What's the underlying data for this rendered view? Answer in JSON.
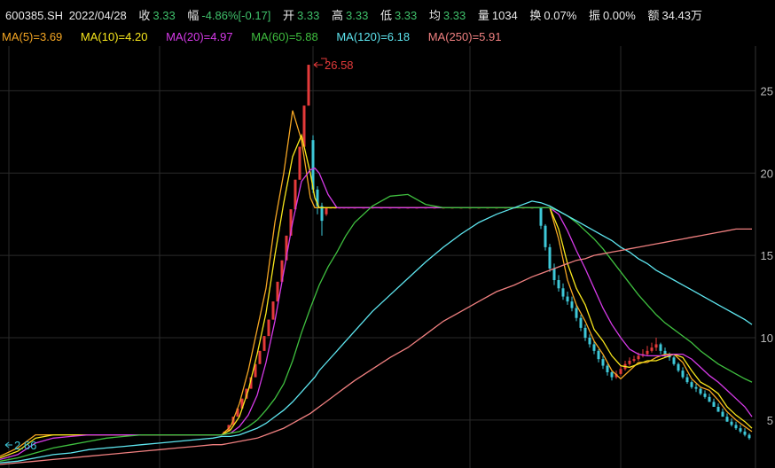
{
  "header": {
    "code": "600385.SH",
    "date": "2022/04/28",
    "close_label": "收",
    "close_value": "3.33",
    "change_label": "幅",
    "change_value": "-4.86%[-0.17]",
    "open_label": "开",
    "open_value": "3.33",
    "high_label": "高",
    "high_value": "3.33",
    "low_label": "低",
    "low_value": "3.33",
    "avg_label": "均",
    "avg_value": "3.33",
    "volume_label": "量",
    "volume_value": "1034",
    "turnover_label": "换",
    "turnover_value": "0.07%",
    "amplitude_label": "振",
    "amplitude_value": "0.00%",
    "amount_label": "额",
    "amount_value": "34.43万"
  },
  "ma_legend": [
    {
      "label": "MA(5)=3.69",
      "color": "#f5a623"
    },
    {
      "label": "MA(10)=4.20",
      "color": "#f8e71c"
    },
    {
      "label": "MA(20)=4.97",
      "color": "#d63ae8"
    },
    {
      "label": "MA(60)=5.88",
      "color": "#3fbf3f"
    },
    {
      "label": "MA(120)=6.18",
      "color": "#5ee6f0"
    },
    {
      "label": "MA(250)=5.91",
      "color": "#f08080"
    }
  ],
  "colors": {
    "up": "#e33a3a",
    "down": "#3ec8d8",
    "grid": "#2a2a2a",
    "annotation": "#e33a3a",
    "low_annotation": "#3ec8d8"
  },
  "chart_data": {
    "type": "line",
    "title": "",
    "x": [
      0,
      20,
      40,
      60,
      80,
      100,
      120,
      140,
      160,
      180,
      200,
      220,
      240,
      250,
      260,
      270,
      280,
      290,
      300,
      310,
      320,
      330,
      340,
      350,
      355,
      360,
      370,
      380,
      390,
      400,
      420,
      440,
      460,
      480,
      500,
      520,
      540,
      560,
      580,
      600,
      610,
      620,
      630,
      640,
      650,
      660,
      670,
      680,
      690,
      700,
      710,
      720,
      730,
      740,
      750,
      760,
      770,
      780,
      790,
      800,
      810,
      820,
      830,
      840,
      848
    ],
    "ylim": [
      2.3,
      27.5
    ],
    "y_ticks": [
      5,
      10,
      15,
      20,
      25
    ],
    "y_tick_labels": [
      "5",
      "10",
      "15",
      "20",
      "25"
    ],
    "grid": true,
    "series": [
      {
        "label_ref": "MA(5)",
        "color": "#f5a623",
        "values": [
          2.8,
          3.3,
          4.1,
          4.1,
          4.1,
          4.1,
          4.1,
          4.1,
          4.1,
          4.1,
          4.1,
          4.1,
          4.1,
          4.1,
          4.6,
          6,
          8,
          10.5,
          13,
          17,
          20,
          23.8,
          22,
          18.5,
          17.9,
          17.9,
          17.9,
          17.9,
          17.9,
          17.9,
          17.9,
          17.9,
          17.9,
          17.9,
          17.9,
          17.9,
          17.9,
          17.9,
          17.9,
          17.9,
          17.9,
          17.9,
          16,
          13.5,
          12,
          11,
          9.8,
          9,
          8,
          7.5,
          8,
          8.5,
          8.5,
          8.8,
          9,
          9,
          8.5,
          7.5,
          7,
          6.8,
          6.2,
          5.5,
          5,
          4.6,
          4.3
        ]
      },
      {
        "label_ref": "MA(10)",
        "color": "#f8e71c",
        "values": [
          2.7,
          3.1,
          3.9,
          4.1,
          4.1,
          4.1,
          4.1,
          4.1,
          4.1,
          4.1,
          4.1,
          4.1,
          4.1,
          4.1,
          4.4,
          5.2,
          6.8,
          9,
          11.5,
          15,
          18.2,
          21,
          22.3,
          20,
          18.5,
          17.9,
          17.9,
          17.9,
          17.9,
          17.9,
          17.9,
          17.9,
          17.9,
          17.9,
          17.9,
          17.9,
          17.9,
          17.9,
          17.9,
          17.9,
          17.9,
          17.9,
          16.6,
          14.5,
          13,
          12,
          10.5,
          9.8,
          8.9,
          8.3,
          8.2,
          8.4,
          8.6,
          8.6,
          8.8,
          9,
          8.8,
          8,
          7.3,
          7,
          6.6,
          5.8,
          5.3,
          4.9,
          4.5
        ]
      },
      {
        "label_ref": "MA(20)",
        "color": "#d63ae8",
        "values": [
          2.6,
          2.9,
          3.6,
          3.9,
          4,
          4.1,
          4.1,
          4.1,
          4.1,
          4.1,
          4.1,
          4.1,
          4.1,
          4.1,
          4.2,
          4.6,
          5.3,
          6.5,
          8.5,
          11,
          14,
          17,
          19.5,
          20.2,
          20.3,
          20,
          18.7,
          17.9,
          17.9,
          17.9,
          17.9,
          17.9,
          17.9,
          17.9,
          17.9,
          17.9,
          17.9,
          17.9,
          17.9,
          17.9,
          17.9,
          17.9,
          17.5,
          16.5,
          15.3,
          14.2,
          13,
          11.8,
          10.8,
          10,
          9.3,
          9,
          8.9,
          8.9,
          8.9,
          9,
          9,
          8.7,
          8.2,
          7.7,
          7.3,
          6.8,
          6.3,
          5.8,
          5.2
        ]
      },
      {
        "label_ref": "MA(60)",
        "color": "#3fbf3f",
        "values": [
          2.5,
          2.7,
          3,
          3.3,
          3.5,
          3.7,
          3.9,
          4,
          4.1,
          4.1,
          4.1,
          4.1,
          4.1,
          4.1,
          4.2,
          4.3,
          4.6,
          5,
          5.6,
          6.3,
          7.2,
          8.6,
          10.3,
          11.8,
          12.5,
          13.2,
          14.3,
          15.2,
          16.2,
          17,
          18,
          18.6,
          18.7,
          18.1,
          17.9,
          17.9,
          17.9,
          17.9,
          17.9,
          17.9,
          17.9,
          17.9,
          17.7,
          17.4,
          17,
          16.5,
          16,
          15.4,
          14.7,
          14,
          13.3,
          12.6,
          12,
          11.4,
          10.9,
          10.5,
          10.1,
          9.7,
          9.2,
          8.8,
          8.4,
          8.1,
          7.8,
          7.5,
          7.3
        ]
      },
      {
        "label_ref": "MA(120)",
        "color": "#5ee6f0",
        "values": [
          2.4,
          2.5,
          2.7,
          2.9,
          3,
          3.2,
          3.3,
          3.4,
          3.5,
          3.6,
          3.7,
          3.8,
          3.9,
          4,
          4,
          4.1,
          4.3,
          4.5,
          4.8,
          5.2,
          5.6,
          6.1,
          6.7,
          7.3,
          7.6,
          8,
          8.6,
          9.2,
          9.8,
          10.4,
          11.6,
          12.6,
          13.6,
          14.6,
          15.5,
          16.3,
          17,
          17.5,
          17.9,
          18.3,
          18.2,
          18,
          17.7,
          17.4,
          17.1,
          16.8,
          16.5,
          16.2,
          15.9,
          15.5,
          15.2,
          14.8,
          14.5,
          14.1,
          13.8,
          13.5,
          13.2,
          12.9,
          12.6,
          12.3,
          12,
          11.7,
          11.4,
          11.1,
          10.8
        ]
      },
      {
        "label_ref": "MA(250)",
        "color": "#f08080",
        "values": [
          2.3,
          2.4,
          2.5,
          2.6,
          2.7,
          2.8,
          2.9,
          3,
          3.1,
          3.2,
          3.3,
          3.4,
          3.5,
          3.5,
          3.6,
          3.7,
          3.8,
          3.9,
          4.1,
          4.3,
          4.5,
          4.8,
          5.1,
          5.4,
          5.6,
          5.8,
          6.2,
          6.6,
          7,
          7.4,
          8.1,
          8.8,
          9.4,
          10.2,
          11,
          11.6,
          12.2,
          12.8,
          13.2,
          13.7,
          13.9,
          14.1,
          14.3,
          14.5,
          14.7,
          14.8,
          15,
          15.1,
          15.2,
          15.3,
          15.4,
          15.5,
          15.6,
          15.7,
          15.8,
          15.9,
          16,
          16.1,
          16.2,
          16.3,
          16.4,
          16.5,
          16.6,
          16.6,
          16.6
        ]
      }
    ],
    "candles": {
      "x": [
        253,
        258,
        263,
        268,
        273,
        278,
        283,
        288,
        293,
        298,
        303,
        308,
        313,
        318,
        323,
        328,
        333,
        338,
        343,
        348,
        353,
        358,
        363,
        368,
        373,
        378,
        383,
        388,
        393,
        400,
        410,
        420,
        430,
        440,
        450,
        460,
        470,
        480,
        490,
        500,
        510,
        520,
        530,
        540,
        550,
        560,
        570,
        580,
        590,
        600,
        610,
        615,
        620,
        625,
        630,
        635,
        640,
        645,
        650,
        655,
        660,
        665,
        670,
        675,
        680,
        685,
        690,
        695,
        700,
        705,
        710,
        715,
        720,
        725,
        730,
        735,
        740,
        745,
        750,
        755,
        760,
        765,
        770,
        775,
        780,
        785,
        790,
        795,
        800,
        805,
        810,
        815,
        820,
        825,
        830,
        835,
        840,
        845
      ],
      "open": [
        4.1,
        4.3,
        4.7,
        5.2,
        5.7,
        6.3,
        6.9,
        7.6,
        8.4,
        9.2,
        10.1,
        11.1,
        12.2,
        13.4,
        14.7,
        16.2,
        17.8,
        19.6,
        21.6,
        24.1,
        22,
        19,
        18,
        17.5,
        17.9,
        17.9,
        17.9,
        17.9,
        17.9,
        17.9,
        17.9,
        17.9,
        17.9,
        17.9,
        17.9,
        17.9,
        17.9,
        17.9,
        17.9,
        17.9,
        17.9,
        17.9,
        17.9,
        17.9,
        17.9,
        17.9,
        17.9,
        17.9,
        17.9,
        17.9,
        17.9,
        16.8,
        15.5,
        14.2,
        13.5,
        13,
        12.5,
        12.2,
        11.8,
        11.2,
        10.6,
        10,
        9.6,
        9.2,
        8.7,
        8.3,
        7.9,
        7.6,
        7.8,
        8.1,
        8.4,
        8.6,
        8.7,
        8.9,
        9,
        9.2,
        9.4,
        9.6,
        9.2,
        9,
        8.8,
        8.4,
        8,
        7.6,
        7.3,
        7,
        6.9,
        6.6,
        6.4,
        6.1,
        5.8,
        5.5,
        5.2,
        4.9,
        4.7,
        4.5,
        4.3,
        4.1
      ],
      "close": [
        4.3,
        4.7,
        5.2,
        5.7,
        6.3,
        6.9,
        7.6,
        8.4,
        9.2,
        10.1,
        11.1,
        12.2,
        13.4,
        14.7,
        16.2,
        17.8,
        19.6,
        21.6,
        24.1,
        26.58,
        19,
        18,
        17.1,
        17.9,
        17.9,
        17.9,
        17.9,
        17.9,
        17.9,
        17.9,
        17.9,
        17.9,
        17.9,
        17.9,
        17.9,
        17.9,
        17.9,
        17.9,
        17.9,
        17.9,
        17.9,
        17.9,
        17.9,
        17.9,
        17.9,
        17.9,
        17.9,
        17.9,
        17.9,
        17.9,
        16.8,
        15.5,
        14.2,
        13.5,
        13,
        12.5,
        12.2,
        11.8,
        11.2,
        10.6,
        10,
        9.6,
        9.2,
        8.7,
        8.3,
        7.9,
        7.6,
        7.8,
        8.1,
        8.4,
        8.6,
        8.7,
        8.9,
        9,
        9.2,
        9.4,
        9.6,
        9.2,
        9,
        8.8,
        8.4,
        8,
        7.6,
        7.3,
        7,
        6.9,
        6.6,
        6.4,
        6.1,
        5.8,
        5.5,
        5.2,
        4.9,
        4.7,
        4.5,
        4.3,
        4.1,
        3.9
      ],
      "high": [
        4.3,
        4.7,
        5.2,
        5.7,
        6.3,
        6.9,
        7.6,
        8.4,
        9.2,
        10.1,
        11.1,
        12.2,
        13.4,
        14.7,
        16.2,
        17.8,
        19.6,
        21.6,
        24.1,
        26.58,
        22.3,
        19.2,
        18.2,
        17.9,
        17.9,
        17.9,
        17.9,
        17.9,
        17.9,
        17.9,
        17.9,
        17.9,
        17.9,
        17.9,
        17.9,
        17.9,
        17.9,
        17.9,
        17.9,
        17.9,
        17.9,
        17.9,
        17.9,
        17.9,
        17.9,
        17.9,
        17.9,
        17.9,
        17.9,
        17.9,
        17.9,
        16.9,
        15.7,
        14.5,
        13.8,
        13.3,
        12.8,
        12.5,
        12,
        11.4,
        10.8,
        10.2,
        9.8,
        9.3,
        8.9,
        8.4,
        8,
        8,
        8.3,
        8.6,
        8.8,
        8.9,
        9.1,
        9.3,
        9.5,
        9.7,
        10,
        9.7,
        9.4,
        9.1,
        8.9,
        8.5,
        8.2,
        7.8,
        7.4,
        7.2,
        7,
        6.8,
        6.6,
        6.3,
        6,
        5.7,
        5.4,
        5.1,
        4.9,
        4.7,
        4.5,
        4.2
      ],
      "low": [
        4.1,
        4.3,
        4.7,
        5.2,
        5.7,
        6.3,
        6.9,
        7.6,
        8.4,
        9.2,
        10.1,
        11.1,
        12.2,
        13.4,
        14.7,
        16.2,
        17.8,
        19.6,
        21.6,
        24.1,
        18.8,
        17.5,
        16.2,
        17.4,
        17.9,
        17.9,
        17.9,
        17.9,
        17.9,
        17.9,
        17.9,
        17.9,
        17.9,
        17.9,
        17.9,
        17.9,
        17.9,
        17.9,
        17.9,
        17.9,
        17.9,
        17.9,
        17.9,
        17.9,
        17.9,
        17.9,
        17.9,
        17.9,
        17.9,
        17.9,
        16.6,
        15.3,
        14,
        13.2,
        12.8,
        12.3,
        12,
        11.6,
        11,
        10.4,
        9.8,
        9.4,
        9,
        8.5,
        8.1,
        7.7,
        7.4,
        7.5,
        7.7,
        8,
        8.3,
        8.5,
        8.6,
        8.8,
        8.9,
        9.1,
        9.2,
        9,
        8.8,
        8.6,
        8.3,
        7.9,
        7.5,
        7.2,
        6.9,
        6.7,
        6.5,
        6.3,
        6.1,
        5.8,
        5.5,
        5.2,
        4.9,
        4.6,
        4.4,
        4.2,
        4,
        3.8
      ]
    },
    "annotations": [
      {
        "text": "26.58",
        "role": "high"
      },
      {
        "text": "2.66",
        "role": "low"
      }
    ]
  }
}
